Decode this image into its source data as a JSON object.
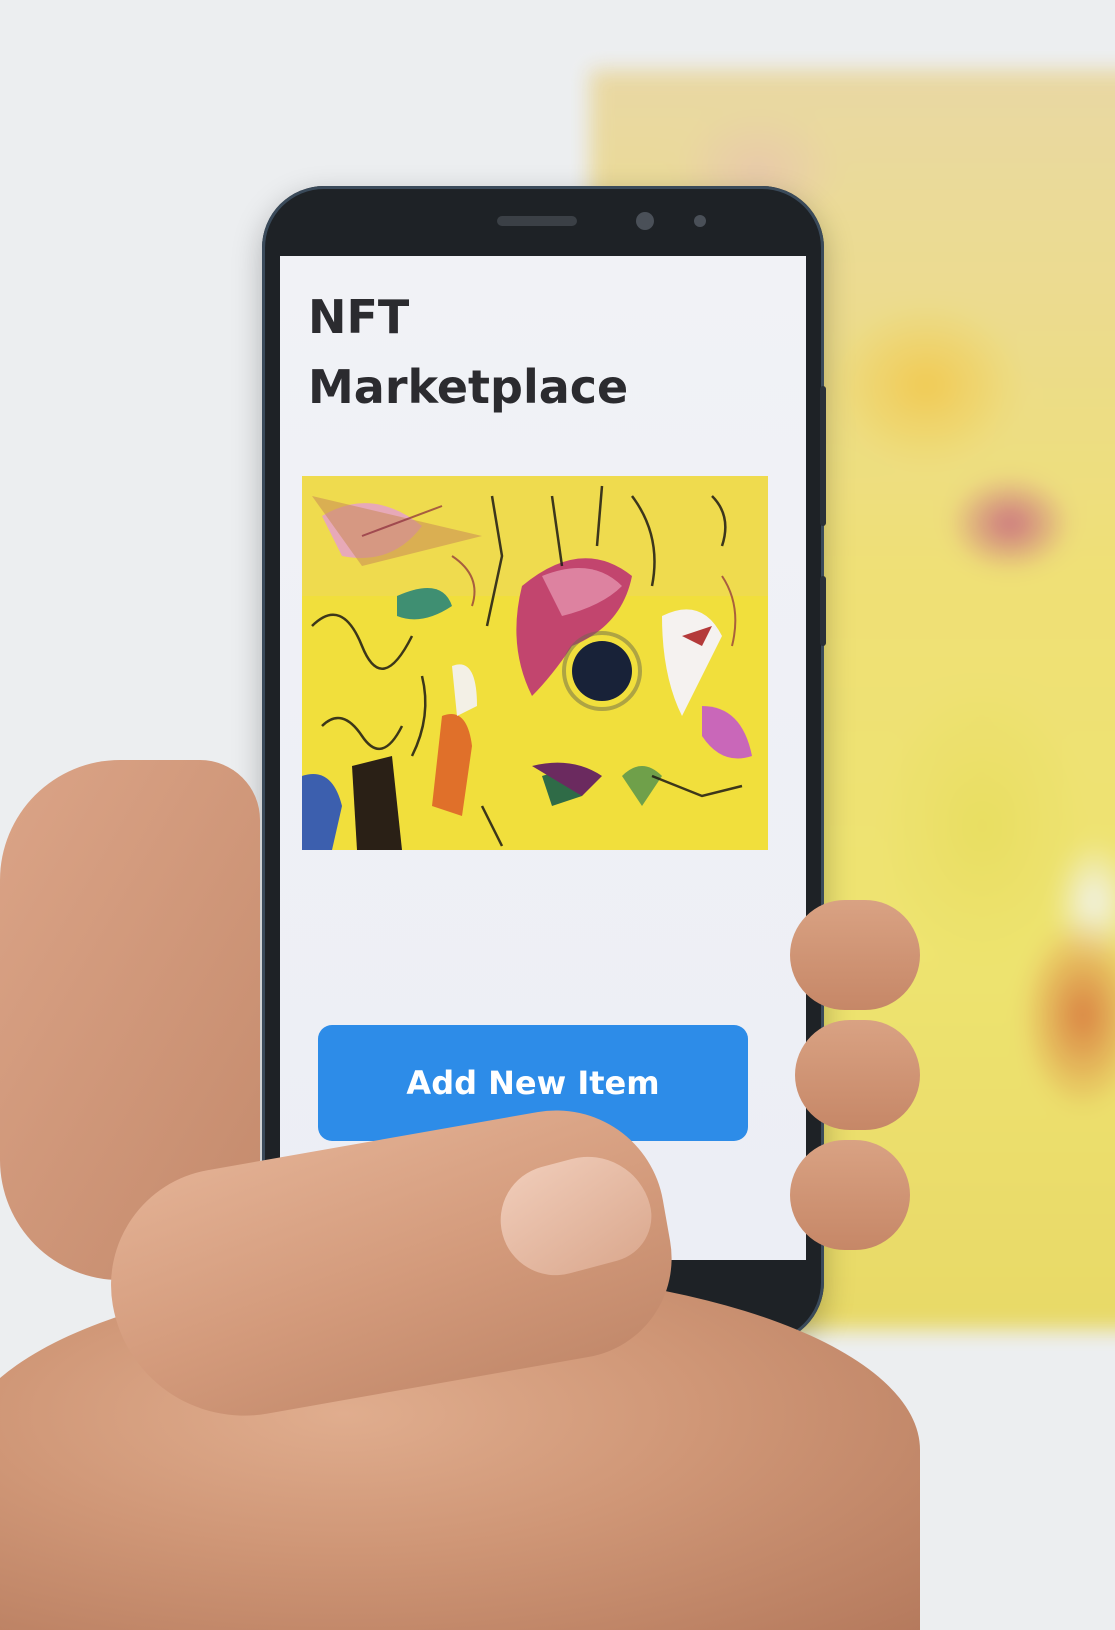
{
  "app": {
    "title": "NFT Marketplace"
  },
  "main": {
    "artwork_name": "abstract-painting"
  },
  "actions": {
    "add_item_label": "Add New Item"
  },
  "colors": {
    "button": "#2d8ce8",
    "screen_bg": "#f1f2f6",
    "title_text": "#2b2b2f",
    "artwork_bg": "#f2e24a"
  }
}
